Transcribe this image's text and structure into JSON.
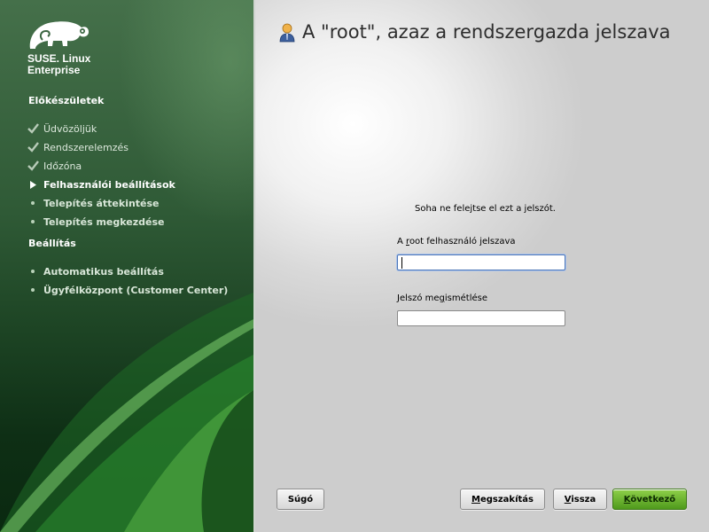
{
  "sidebar": {
    "brand_line1": "SUSE. Linux",
    "brand_line2": "Enterprise",
    "sections": [
      {
        "title": "Előkészületek",
        "steps": [
          {
            "label": "Üdvözöljük",
            "state": "done",
            "icon": "checkmark-icon"
          },
          {
            "label": "Rendszerelemzés",
            "state": "done",
            "icon": "checkmark-icon"
          },
          {
            "label": "Időzóna",
            "state": "done",
            "icon": "checkmark-icon"
          },
          {
            "label": "Felhasználói beállítások",
            "state": "current",
            "icon": "arrow-right-icon"
          },
          {
            "label": "Telepítés áttekintése",
            "state": "todo",
            "icon": "bullet-icon"
          },
          {
            "label": "Telepítés megkezdése",
            "state": "todo",
            "icon": "bullet-icon"
          }
        ]
      },
      {
        "title": "Beállítás",
        "steps": [
          {
            "label": "Automatikus beállítás",
            "state": "todo",
            "icon": "bullet-icon"
          },
          {
            "label": "Ügyfélközpont (Customer Center)",
            "state": "todo",
            "icon": "bullet-icon"
          }
        ]
      }
    ]
  },
  "main": {
    "title": "A \"root\", azaz a rendszergazda jelszava",
    "title_icon": "user-icon",
    "reminder": "Soha ne felejtse el ezt a jelszót.",
    "password": {
      "label_before": "A ",
      "label_mnemonic": "r",
      "label_after": "oot felhasználó jelszava",
      "value": ""
    },
    "confirm": {
      "label_before": "Jelszó me",
      "label_mnemonic": "g",
      "label_after": "ismétlése",
      "value": ""
    }
  },
  "buttons": {
    "help": "Súgó",
    "abort_mnemonic": "M",
    "abort_rest": "egszakítás",
    "back_mnemonic": "V",
    "back_rest": "issza",
    "next_mnemonic": "K",
    "next_rest": "övetkező"
  },
  "colors": {
    "sidebar_green": "#2f5a36",
    "next_button_green": "#6cb431",
    "focus_blue": "#4f78b8"
  }
}
